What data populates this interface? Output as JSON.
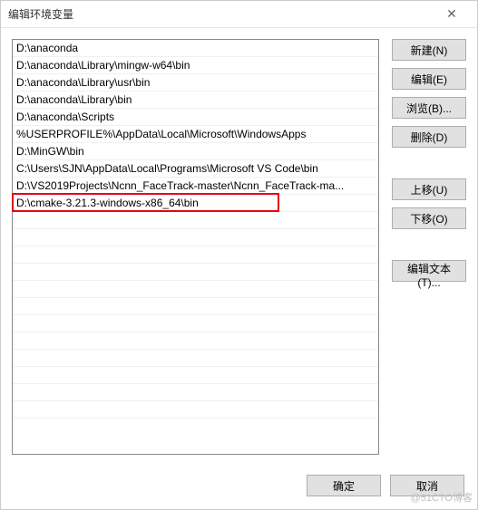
{
  "title": "编辑环境变量",
  "list": {
    "items": [
      "D:\\anaconda",
      "D:\\anaconda\\Library\\mingw-w64\\bin",
      "D:\\anaconda\\Library\\usr\\bin",
      "D:\\anaconda\\Library\\bin",
      "D:\\anaconda\\Scripts",
      "%USERPROFILE%\\AppData\\Local\\Microsoft\\WindowsApps",
      "D:\\MinGW\\bin",
      "C:\\Users\\SJN\\AppData\\Local\\Programs\\Microsoft VS Code\\bin",
      "D:\\VS2019Projects\\Ncnn_FaceTrack-master\\Ncnn_FaceTrack-ma...",
      "D:\\cmake-3.21.3-windows-x86_64\\bin"
    ],
    "highlighted_index": 9
  },
  "buttons": {
    "new": "新建(N)",
    "edit": "编辑(E)",
    "browse": "浏览(B)...",
    "delete": "删除(D)",
    "moveup": "上移(U)",
    "movedown": "下移(O)",
    "edittext": "编辑文本(T)...",
    "ok": "确定",
    "cancel": "取消"
  },
  "watermark": "@51CTO博客"
}
